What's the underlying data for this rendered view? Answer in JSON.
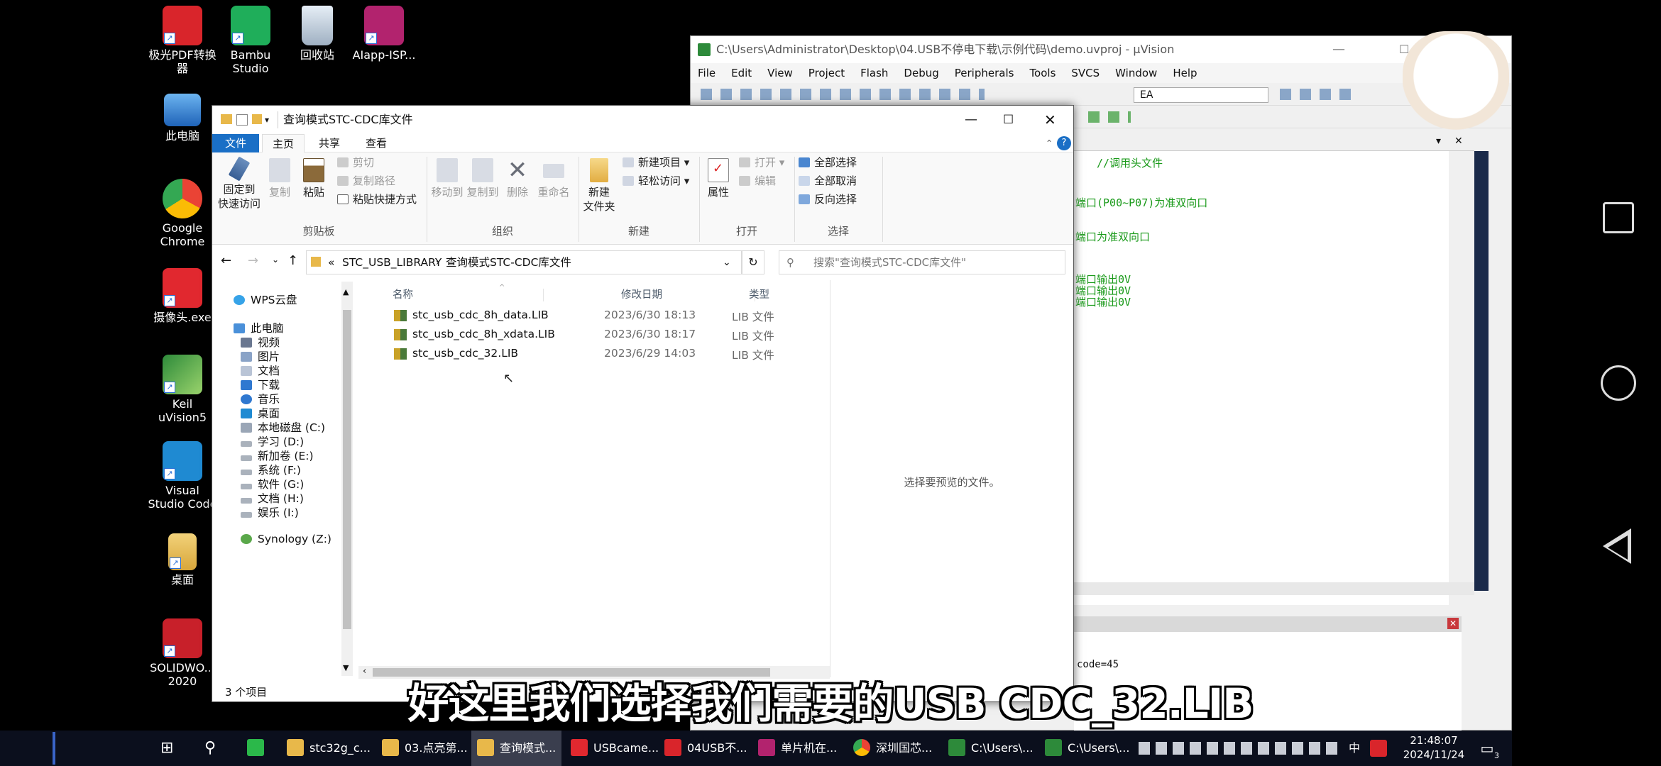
{
  "desktop": {
    "icons": [
      {
        "label": "极光PDF转换\n器",
        "name": "jiguang-pdf-icon"
      },
      {
        "label": "Bambu\nStudio",
        "name": "bambu-studio-icon"
      },
      {
        "label": "回收站",
        "name": "recycle-bin-icon"
      },
      {
        "label": "AIapp-ISP...",
        "name": "aiapp-isp-icon"
      },
      {
        "label": "此电脑",
        "name": "this-pc-icon"
      },
      {
        "label": "Google\nChrome",
        "name": "chrome-icon"
      },
      {
        "label": "摄像头.exe",
        "name": "camera-exe-icon"
      },
      {
        "label": "Keil\nuVision5",
        "name": "keil-icon"
      },
      {
        "label": "Visual\nStudio Code",
        "name": "vscode-icon"
      },
      {
        "label": "桌面",
        "name": "desktop-folder-icon"
      },
      {
        "label": "SOLIDWO...\n2020",
        "name": "solidworks-icon"
      }
    ]
  },
  "keil": {
    "title": "C:\\Users\\Administrator\\Desktop\\04.USB不停电下载\\示例代码\\demo.uvproj - µVision",
    "menu": [
      "File",
      "Edit",
      "View",
      "Project",
      "Flash",
      "Debug",
      "Peripherals",
      "Tools",
      "SVCS",
      "Window",
      "Help"
    ],
    "target_value": "EA",
    "code_lines": [
      "//调用头文件",
      "端口(P00~P07)为准双向口",
      "端口为准双向口",
      "端口输出0V",
      "端口输出0V",
      "端口输出0V"
    ],
    "output_text": "code=45"
  },
  "explorer": {
    "window_title": "查询模式STC-CDC库文件",
    "tabs": [
      "文件",
      "主页",
      "共享",
      "查看"
    ],
    "ribbon": {
      "pin": "固定到\n快速访问",
      "copy": "复制",
      "paste": "粘贴",
      "cut": "剪切",
      "copy_path": "复制路径",
      "paste_shortcut": "粘贴快捷方式",
      "clipboard_group": "剪贴板",
      "move_to": "移动到",
      "copy_to": "复制到",
      "delete": "删除",
      "rename": "重命名",
      "organize_group": "组织",
      "new_folder": "新建\n文件夹",
      "new_item": "新建项目",
      "easy_access": "轻松访问",
      "new_group": "新建",
      "properties": "属性",
      "open": "打开",
      "edit": "编辑",
      "open_group": "打开",
      "select_all": "全部选择",
      "select_none": "全部取消",
      "invert_select": "反向选择",
      "select_group": "选择"
    },
    "address": {
      "prefix": "«",
      "crumb1": "STC_USB_LIBRARY",
      "crumb2": "查询模式STC-CDC库文件"
    },
    "search_placeholder": "搜索\"查询模式STC-CDC库文件\"",
    "nav": [
      "WPS云盘",
      "此电脑",
      "视频",
      "图片",
      "文档",
      "下载",
      "音乐",
      "桌面",
      "本地磁盘 (C:)",
      "学习 (D:)",
      "新加卷 (E:)",
      "系统 (F:)",
      "软件 (G:)",
      "文档 (H:)",
      "娱乐 (I:)",
      "Synology (Z:)"
    ],
    "columns": {
      "name": "名称",
      "date": "修改日期",
      "type": "类型"
    },
    "files": [
      {
        "name": "stc_usb_cdc_8h_data.LIB",
        "date": "2023/6/30 18:13",
        "type": "LIB 文件"
      },
      {
        "name": "stc_usb_cdc_8h_xdata.LIB",
        "date": "2023/6/30 18:17",
        "type": "LIB 文件"
      },
      {
        "name": "stc_usb_cdc_32.LIB",
        "date": "2023/6/29 14:03",
        "type": "LIB 文件"
      }
    ],
    "preview_text": "选择要预览的文件。",
    "status": "3 个项目"
  },
  "taskbar": {
    "items": [
      "stc32g_c...",
      "03.点亮第...",
      "查询模式...",
      "USBcame...",
      "04USB不...",
      "单片机在...",
      "深圳国芯...",
      "C:\\Users\\...",
      "C:\\Users\\..."
    ],
    "ime": "中",
    "time": "21:48:07",
    "date": "2024/11/24",
    "notification_count": "3"
  },
  "subtitle": "好这里我们选择我们需要的USB CDC_32.LIB",
  "colors": {
    "accent": "#1a6fc6",
    "taskbar": "#0b0f1d",
    "code": "#1a9a1a",
    "folder": "#e8b84a"
  }
}
